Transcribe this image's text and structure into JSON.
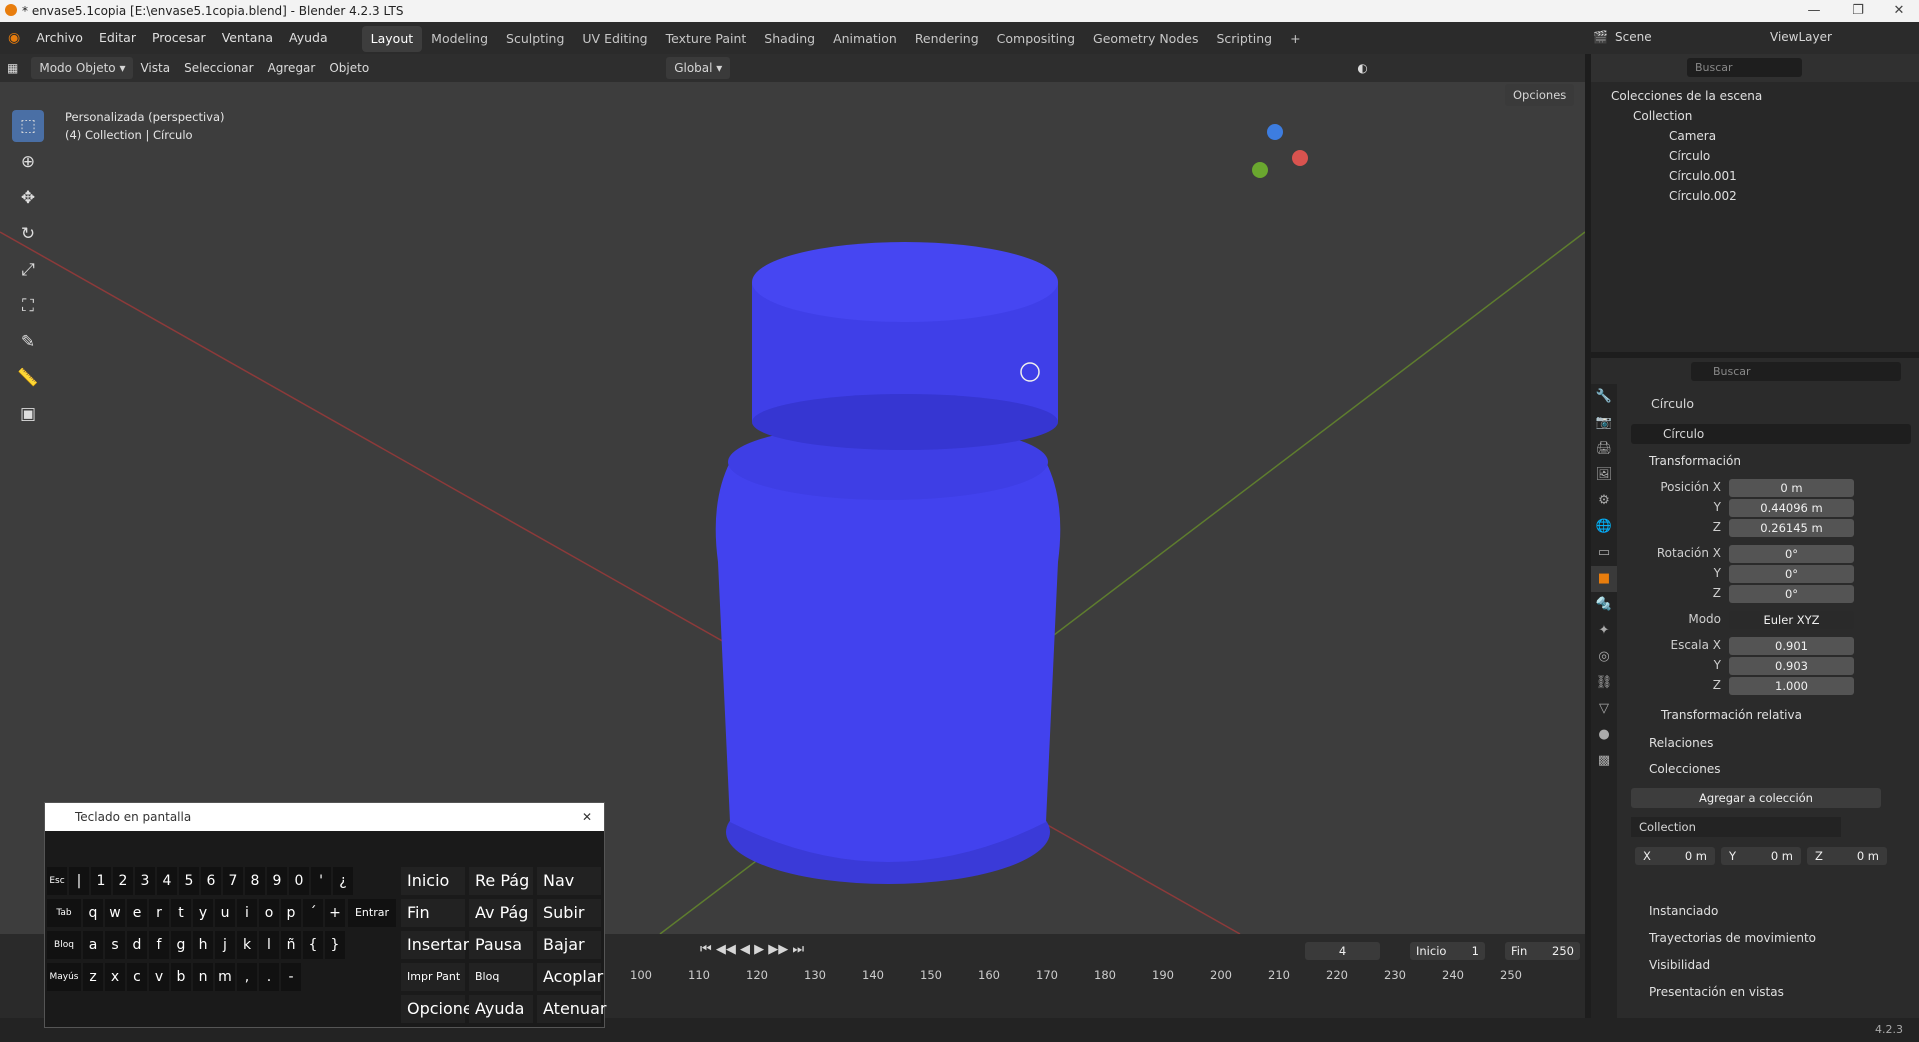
{
  "window": {
    "title": "* envase5.1copia [E:\\envase5.1copia.blend] - Blender 4.2.3 LTS"
  },
  "menu": [
    "Archivo",
    "Editar",
    "Procesar",
    "Ventana",
    "Ayuda"
  ],
  "workspaces": [
    "Layout",
    "Modeling",
    "Sculpting",
    "UV Editing",
    "Texture Paint",
    "Shading",
    "Animation",
    "Rendering",
    "Compositing",
    "Geometry Nodes",
    "Scripting"
  ],
  "scene": {
    "label": "Scene",
    "view_layer": "ViewLayer"
  },
  "viewport_header": {
    "mode": "Modo Objeto",
    "items": [
      "Vista",
      "Seleccionar",
      "Agregar",
      "Objeto"
    ],
    "orientation": "Global",
    "options": "Opciones"
  },
  "viewport": {
    "view_name": "Personalizada (perspectiva)",
    "collection_info": "(4) Collection | Círculo"
  },
  "outliner": {
    "search": "Buscar",
    "root": "Colecciones de la escena",
    "collection": "Collection",
    "items": [
      "Camera",
      "Círculo",
      "Círculo.001",
      "Círculo.002"
    ]
  },
  "properties": {
    "search": "Buscar",
    "object_name": "Círculo",
    "data_name": "Círculo",
    "transform_header": "Transformación",
    "location_label": "Posición X",
    "loc_x": "0 m",
    "loc_y": "0.44096 m",
    "loc_z": "0.26145 m",
    "rotation_label": "Rotación X",
    "rot_x": "0°",
    "rot_y": "0°",
    "rot_z": "0°",
    "mode_label": "Modo",
    "mode_value": "Euler XYZ",
    "scale_label": "Escala X",
    "scale_x": "0.901",
    "scale_y": "0.903",
    "scale_z": "1.000",
    "y": "Y",
    "z": "Z",
    "delta": "Transformación relativa",
    "relations": "Relaciones",
    "collections": "Colecciones",
    "add_collection": "Agregar a colección",
    "collection_value": "Collection",
    "offset_x_label": "X",
    "offset_x": "0 m",
    "offset_y_label": "Y",
    "offset_y": "0 m",
    "offset_z_label": "Z",
    "offset_z": "0 m",
    "instancing": "Instanciado",
    "motion_paths": "Trayectorias de movimiento",
    "visibility": "Visibilidad",
    "viewport_display": "Presentación en vistas"
  },
  "timeline": {
    "current_frame": "4",
    "start_label": "Inicio",
    "start": "1",
    "end_label": "Fin",
    "end": "250",
    "ticks": [
      "100",
      "110",
      "120",
      "130",
      "140",
      "150",
      "160",
      "170",
      "180",
      "190",
      "200",
      "210",
      "220",
      "230",
      "240",
      "250"
    ]
  },
  "status": {
    "version": "4.2.3"
  },
  "keyboard": {
    "title": "Teclado en pantalla",
    "row1": [
      "Esc",
      "|",
      "1",
      "2",
      "3",
      "4",
      "5",
      "6",
      "7",
      "8",
      "9",
      "0",
      "'",
      "¿"
    ],
    "row2": [
      "Tab",
      "q",
      "w",
      "e",
      "r",
      "t",
      "y",
      "u",
      "i",
      "o",
      "p",
      "´",
      "+"
    ],
    "row3": [
      "Bloq Mayús",
      "a",
      "s",
      "d",
      "f",
      "g",
      "h",
      "j",
      "k",
      "l",
      "ñ",
      "{",
      "}"
    ],
    "row4": [
      "Mayús",
      "z",
      "x",
      "c",
      "v",
      "b",
      "n",
      "m",
      ",",
      ".",
      "-"
    ],
    "enter": "Entrar",
    "side": [
      "Inicio",
      "Re Pág",
      "Nav",
      "Fin",
      "Av Pág",
      "Subir",
      "Insertar",
      "Pausa",
      "Bajar",
      "Impr Pant",
      "Bloq Despl",
      "Acoplar",
      "Opciones",
      "Ayuda",
      "Atenuar"
    ]
  }
}
